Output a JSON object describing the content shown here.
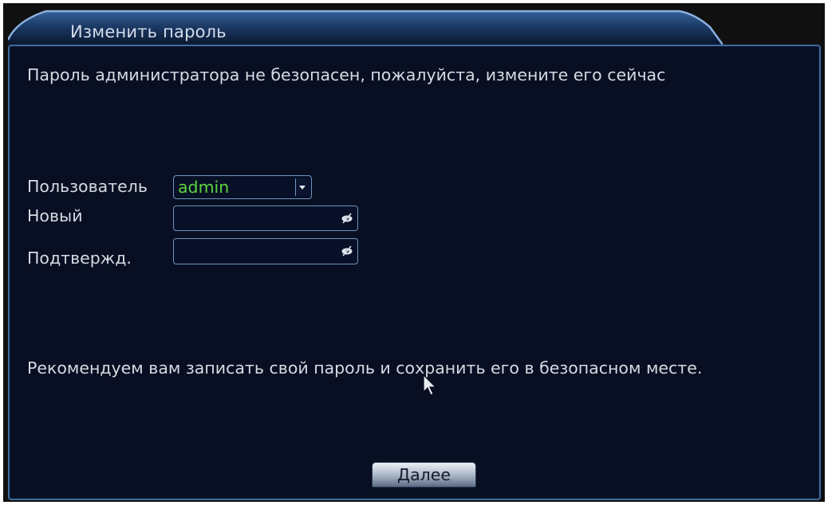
{
  "window": {
    "title": "Изменить пароль"
  },
  "dialog": {
    "warning": "Пароль администратора не безопасен, пожалуйста, измените его сейчас",
    "advice": "Рекомендуем вам записать свой пароль и сохранить его в безопасном месте."
  },
  "form": {
    "user_label": "Пользователь",
    "user_value": "admin",
    "new_label": "Новый",
    "new_value": "",
    "confirm_label": "Подтвержд.",
    "confirm_value": ""
  },
  "buttons": {
    "next_label": "Далее"
  },
  "icons": {
    "dropdown": "chevron-down-icon",
    "password_toggle": "eye-slash-icon",
    "cursor": "mouse-pointer-icon"
  },
  "colors": {
    "background": "#080f22",
    "border": "#3f6a9c",
    "text": "#d6dae2",
    "selected_value": "#5fd43d"
  }
}
